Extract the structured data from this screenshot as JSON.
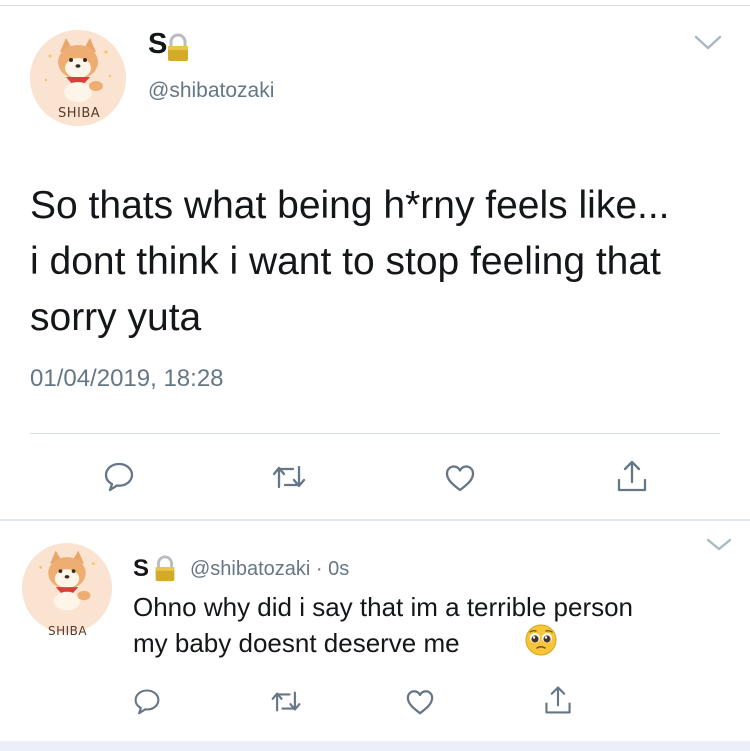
{
  "colors": {
    "text": "#14171a",
    "secondary": "#657786",
    "divider": "#d6dde3",
    "lock_gold": "#c9a227",
    "avatar_bg": "#fbe3d2"
  },
  "tweet": {
    "avatar_badge": "SHIBA",
    "display_name": "S",
    "handle": "@shibatozaki",
    "text_lines": [
      "So thats what being h*rny feels like...",
      "i dont think i want to stop feeling that",
      "sorry yuta"
    ],
    "timestamp": "01/04/2019, 18:28",
    "actions": [
      "reply-icon",
      "retweet-icon",
      "like-icon",
      "share-icon"
    ]
  },
  "reply": {
    "avatar_badge": "SHIBA",
    "display_name": "S",
    "handle_time": "@shibatozaki · 0s",
    "text_lines": [
      "Ohno why did i say that im a terrible person",
      "my baby doesnt deserve me"
    ],
    "emoji": "pleading-face-icon",
    "actions": [
      "reply-icon",
      "retweet-icon",
      "like-icon",
      "share-icon"
    ]
  }
}
